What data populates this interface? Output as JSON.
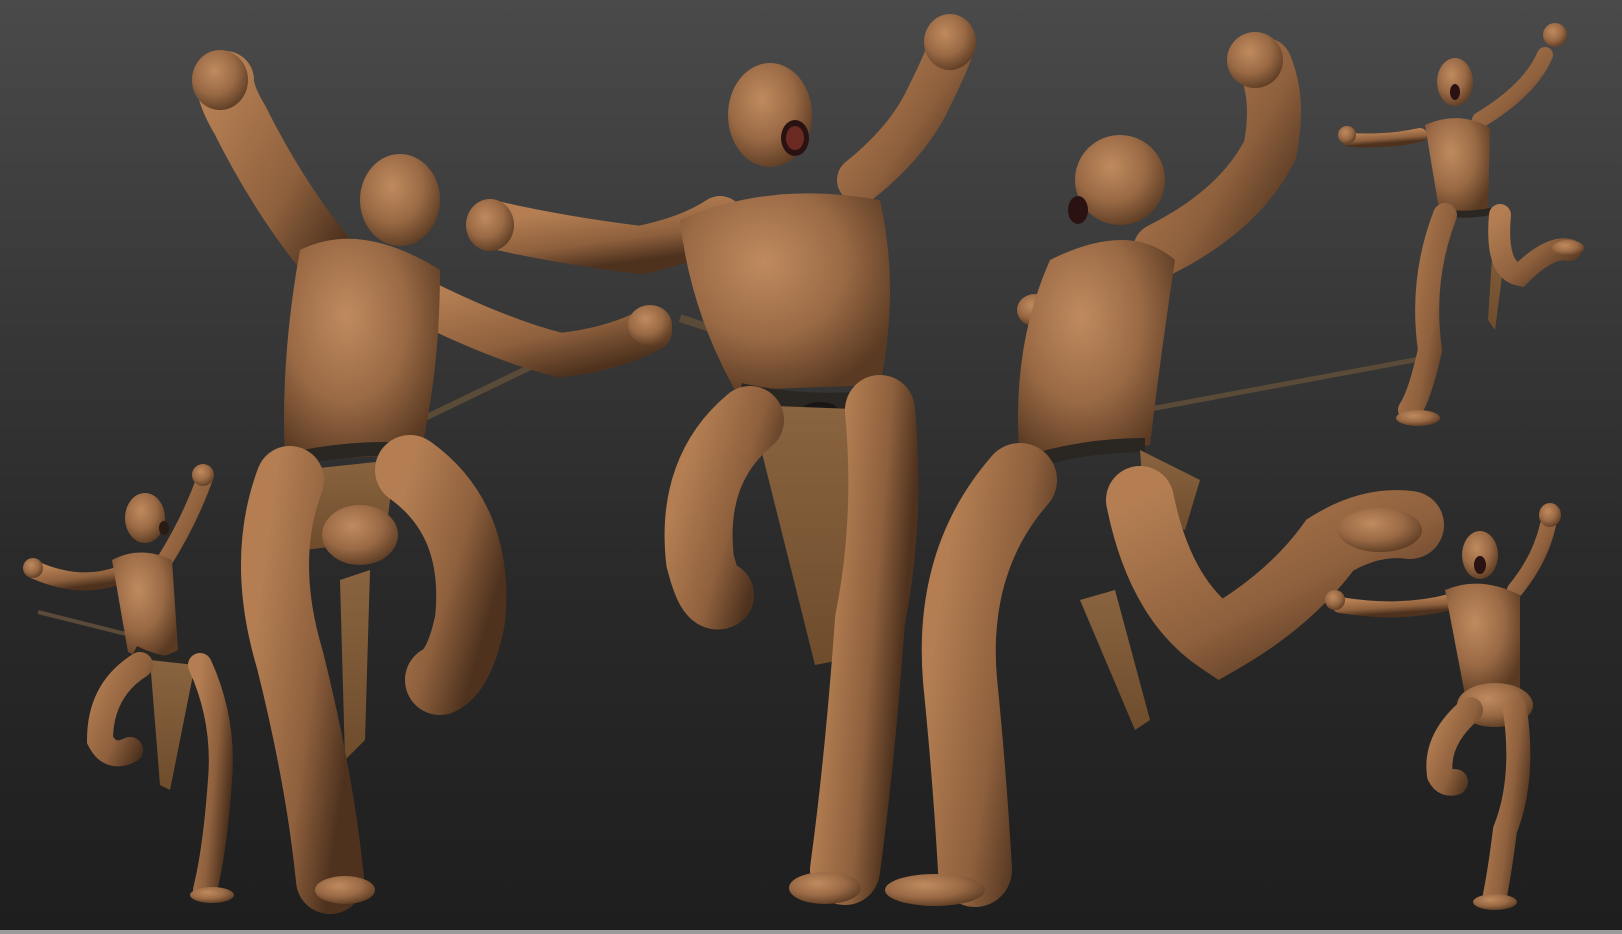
{
  "viewport": {
    "description_label": "",
    "colors": {
      "background_top": "#4a4a4a",
      "background_bottom": "#1e1e1e",
      "skin": "#9a6a45",
      "skin_shadow": "#5a3a22",
      "skin_highlight": "#c08a5e",
      "loincloth": "#8a6440",
      "belt": "#2a2622",
      "spear": "#5a4a38",
      "bottom_border": "#9a9a9a"
    }
  },
  "figures": [
    {
      "name": "small-front-left-figure",
      "view": "front"
    },
    {
      "name": "back-view-figure",
      "view": "back"
    },
    {
      "name": "front-view-figure",
      "view": "front"
    },
    {
      "name": "side-view-figure",
      "view": "side"
    },
    {
      "name": "small-top-right-figure",
      "view": "three-quarter"
    },
    {
      "name": "small-bottom-right-figure",
      "view": "front-nude"
    }
  ]
}
